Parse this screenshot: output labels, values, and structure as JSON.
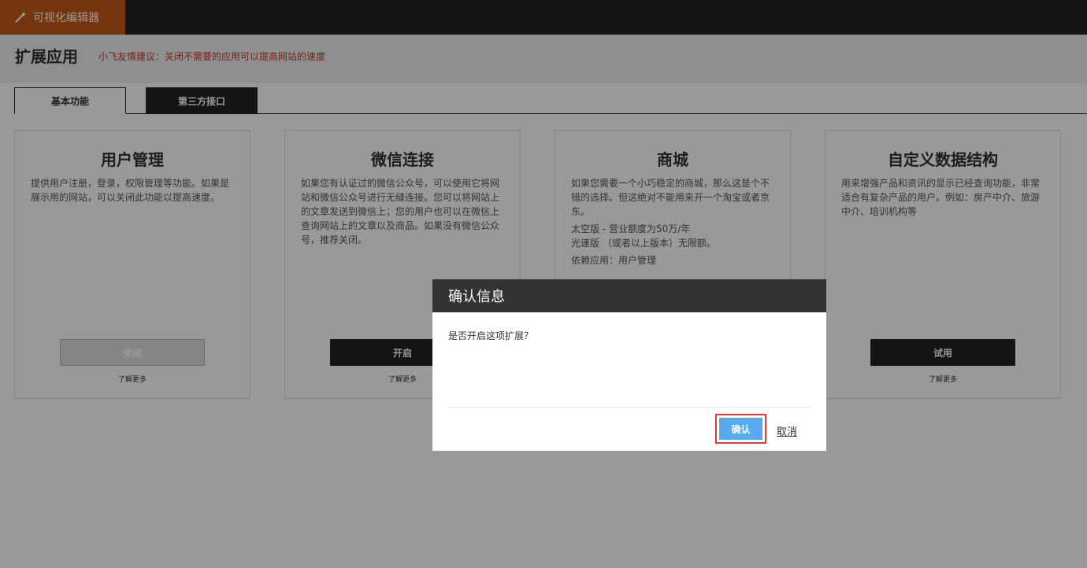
{
  "brand": {
    "label": "可视化编辑器",
    "icon": "magic-wand-icon"
  },
  "page": {
    "title": "扩展应用",
    "tip": "小飞友情建议：关闭不需要的应用可以提高网站的速度"
  },
  "tabs": [
    {
      "label": "基本功能",
      "active": true
    },
    {
      "label": "第三方接口",
      "active": false
    }
  ],
  "cards": [
    {
      "title": "用户管理",
      "desc": "提供用户注册，登录，权限管理等功能。如果是展示用的网站，可以关闭此功能以提高速度。",
      "extra": [],
      "button": "关闭",
      "more": "了解更多"
    },
    {
      "title": "微信连接",
      "desc": "如果您有认证过的微信公众号，可以使用它将网站和微信公众号进行无缝连接。您可以将网站上的文章发送到微信上；您的用户也可以在微信上查询网站上的文章以及商品。如果没有微信公众号，推荐关闭。",
      "extra": [],
      "button": "开启",
      "more": "了解更多"
    },
    {
      "title": "商城",
      "desc": "如果您需要一个小巧稳定的商城，那么这是个不错的选择。但这绝对不能用来开一个淘宝或者京东。",
      "extra": [
        "太空版 - 营业额度为50万/年",
        "光速版 （或者以上版本）无限额。",
        "依赖应用：用户管理"
      ],
      "button": "",
      "more": ""
    },
    {
      "title": "自定义数据结构",
      "desc": "用来增强产品和资讯的显示已经查询功能，非常适合有复杂产品的用户。例如：房产中介、旅游中介、培训机构等",
      "extra": [],
      "button": "试用",
      "more": "了解更多"
    }
  ],
  "modal": {
    "title": "确认信息",
    "message": "是否开启这项扩展？",
    "confirm": "确认",
    "cancel": "取消"
  },
  "colors": {
    "brand_bg": "#c45a1a",
    "topbar_bg": "#222222",
    "tip_text": "#c0392b",
    "confirm_bg": "#55aaf0",
    "highlight": "#e53935"
  }
}
